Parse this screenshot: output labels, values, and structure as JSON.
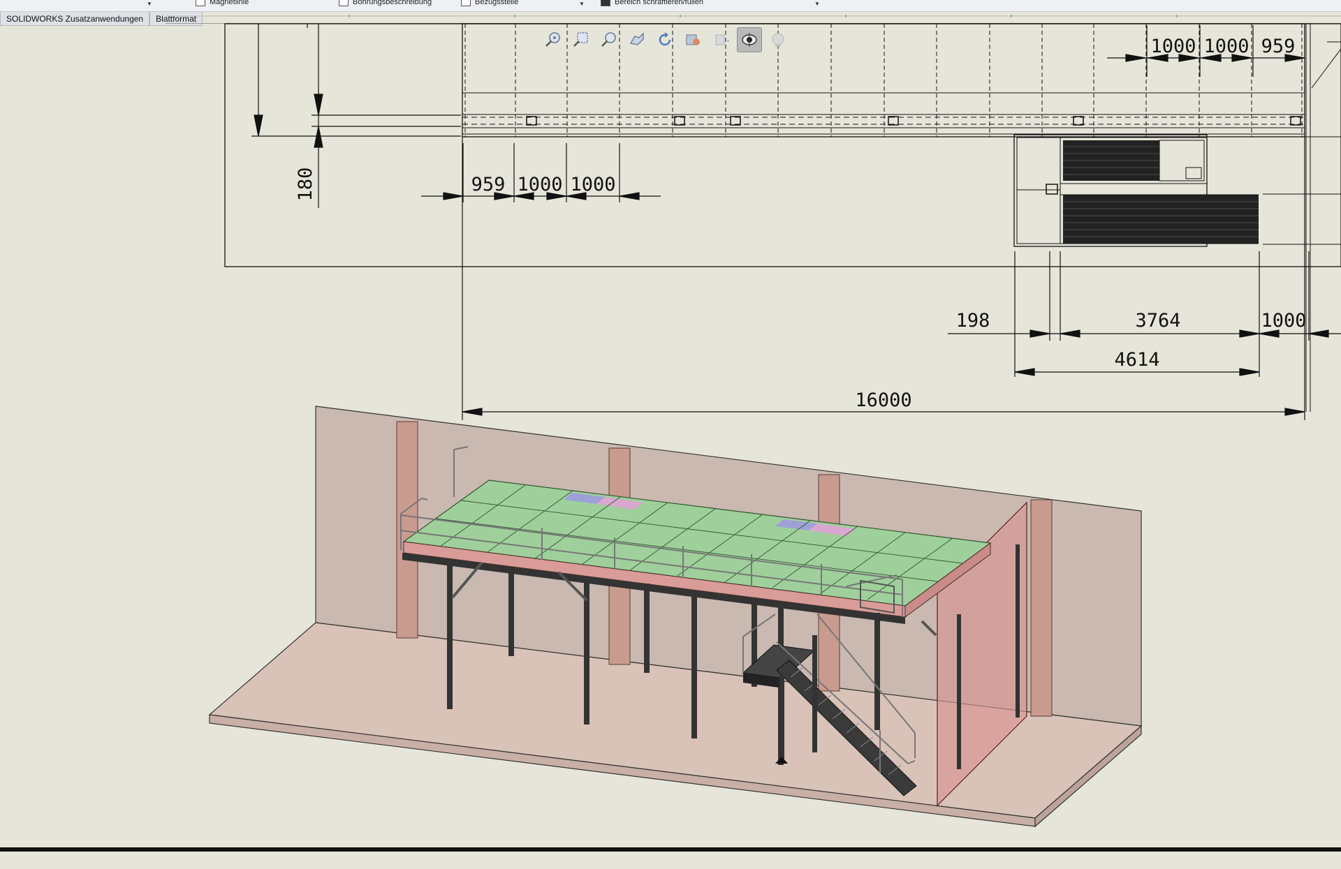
{
  "ribbon": {
    "items": [
      {
        "label": "Magnetlinie",
        "icon": "magnetic-line-icon"
      },
      {
        "label": "Bohrungsbeschreibung",
        "icon": "hole-callout-icon"
      },
      {
        "label": "Bezugsstelle",
        "icon": "datum-target-icon"
      },
      {
        "label": "Bereich schraffieren/füllen",
        "icon": "area-hatch-icon"
      }
    ]
  },
  "tabs": [
    {
      "label": "SOLIDWORKS Zusatzanwendungen"
    },
    {
      "label": "Blattformat"
    }
  ],
  "headsup": [
    {
      "icon": "zoom-to-fit-icon"
    },
    {
      "icon": "zoom-to-area-icon"
    },
    {
      "icon": "zoom-in-out-icon"
    },
    {
      "icon": "pan-icon"
    },
    {
      "icon": "rotate-icon"
    },
    {
      "icon": "display-style-icon"
    },
    {
      "icon": "hide-show-items-icon"
    },
    {
      "icon": "view-orientation-icon",
      "active": true
    },
    {
      "icon": "appearance-icon"
    }
  ],
  "dimensions": {
    "top_right": [
      "1000",
      "1000",
      "959"
    ],
    "left_vertical": "180",
    "left_horizontal": [
      "959",
      "1000",
      "1000"
    ],
    "row_198": "198",
    "row_3764": "3764",
    "row_1000": "1000",
    "row_4614": "4614",
    "overall": "16000"
  },
  "colors": {
    "background": "#e6e5d9",
    "platform_grid": "#9fd09b",
    "platform_purple": "#9ea0d8",
    "platform_pink": "#d8a8d0",
    "wall": "#c9b9b0",
    "floor": "#d9c2b8",
    "column": "#c99b8f",
    "red_panel": "#d99494"
  }
}
